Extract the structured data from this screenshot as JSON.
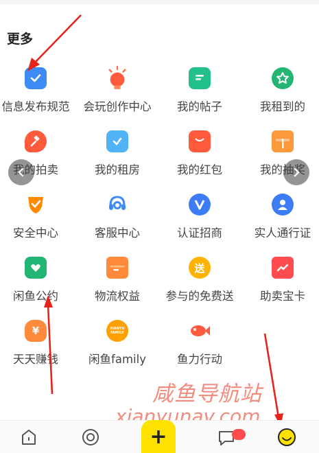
{
  "section_title": "更多",
  "items": [
    {
      "label": "信息发布规范",
      "icon": "check-doc-icon",
      "color": "#3d8bf5"
    },
    {
      "label": "会玩创作中心",
      "icon": "bulb-icon",
      "color": "#ff6a3d"
    },
    {
      "label": "我的帖子",
      "icon": "post-icon",
      "color": "#22c08a"
    },
    {
      "label": "我租到的",
      "icon": "star-badge-icon",
      "color": "#22b573"
    },
    {
      "label": "我的拍卖",
      "icon": "gavel-icon",
      "color": "#ff5a3c"
    },
    {
      "label": "我的租房",
      "icon": "house-check-icon",
      "color": "#4fb3f6"
    },
    {
      "label": "我的红包",
      "icon": "red-packet-icon",
      "color": "#ff5a3c"
    },
    {
      "label": "我的抽奖",
      "icon": "gift-box-icon",
      "color": "#ff9a3c"
    },
    {
      "label": "安全中心",
      "icon": "shield-icon",
      "color": "#ff8a00"
    },
    {
      "label": "客服中心",
      "icon": "headset-icon",
      "color": "#3d8bf5"
    },
    {
      "label": "认证招商",
      "icon": "verified-v-icon",
      "color": "#3d7cf5"
    },
    {
      "label": "实人通行证",
      "icon": "person-icon",
      "color": "#3d7cf5"
    },
    {
      "label": "闲鱼公约",
      "icon": "heart-card-icon",
      "color": "#22b573"
    },
    {
      "label": "物流权益",
      "icon": "logistics-box-icon",
      "color": "#ff8a3c"
    },
    {
      "label": "参与的免费送",
      "icon": "free-give-icon",
      "color": "#ffb300"
    },
    {
      "label": "助卖宝卡",
      "icon": "trend-card-icon",
      "color": "#ff4d4f"
    },
    {
      "label": "天天赚钱",
      "icon": "money-bag-icon",
      "color": "#ff8a3c"
    },
    {
      "label": "闲鱼family",
      "icon": "xianyu-family-icon",
      "color": "#ffa000"
    },
    {
      "label": "鱼力行动",
      "icon": "fish-icon",
      "color": "#ff5a3c"
    }
  ],
  "watermark": {
    "cn": "咸鱼导航站",
    "url": "xianyunav.com"
  },
  "tabbar": {
    "tabs": [
      "home-icon",
      "circle-target-icon",
      "publish-plus-icon",
      "message-icon",
      "profile-smile-icon"
    ],
    "plus_label": "+"
  },
  "colors": {
    "accent_yellow": "#ffe100",
    "annotation_red": "#e6231b"
  }
}
